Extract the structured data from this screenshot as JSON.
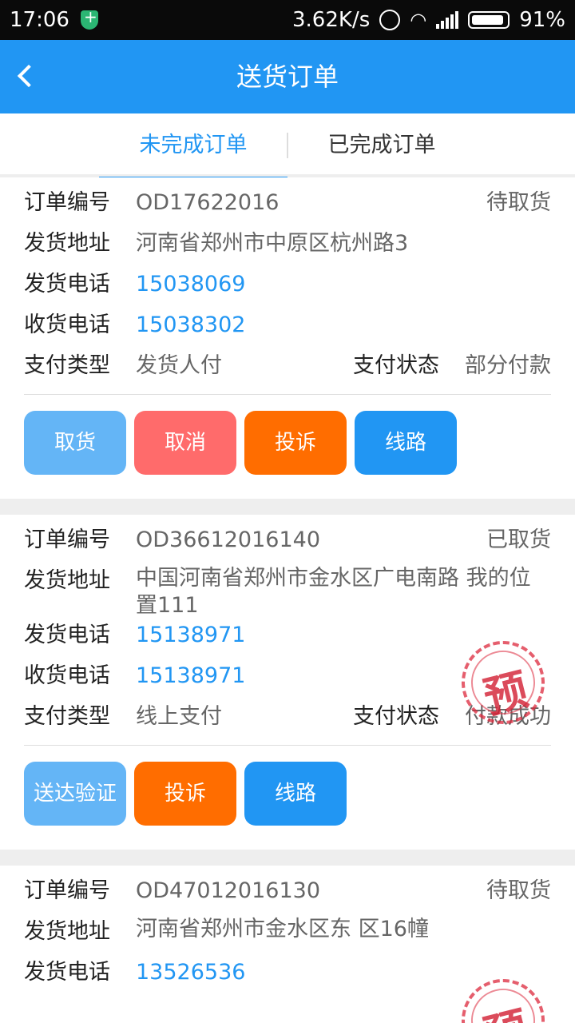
{
  "status_bar": {
    "time": "17:06",
    "speed": "3.62K/s",
    "battery": "91%"
  },
  "header": {
    "title": "送货订单"
  },
  "tabs": [
    {
      "label": "未完成订单",
      "active": true
    },
    {
      "label": "已完成订单",
      "active": false
    }
  ],
  "labels": {
    "order_no": "订单编号",
    "ship_addr": "发货地址",
    "ship_phone": "发货电话",
    "recv_phone": "收货电话",
    "pay_type": "支付类型",
    "pay_status": "支付状态"
  },
  "orders": [
    {
      "order_no": "OD17622016",
      "status": "待取货",
      "ship_addr": "河南省郑州市中原区杭州路3",
      "ship_phone": "15038069",
      "recv_phone": "15038302",
      "pay_type": "发货人付",
      "pay_status": "部分付款",
      "buttons": [
        "取货",
        "取消",
        "投诉",
        "线路"
      ]
    },
    {
      "order_no": "OD36612016140",
      "status": "已取货",
      "ship_addr": "中国河南省郑州市金水区广电南路 我的位置111",
      "ship_phone": "15138971",
      "recv_phone": "15138971",
      "pay_type": "线上支付",
      "pay_status": "付款成功",
      "stamp": "预",
      "buttons": [
        "送达验证",
        "投诉",
        "线路"
      ]
    },
    {
      "order_no": "OD47012016130",
      "status": "待取货",
      "ship_addr": "河南省郑州市金水区东  区16幢",
      "ship_addr_line2": "东  区16幢",
      "ship_phone": "13526536",
      "stamp": "预"
    }
  ],
  "colors": {
    "primary": "#2196f3",
    "light_blue": "#64b5f6",
    "red": "#ff6b6b",
    "orange": "#ff6d00"
  }
}
